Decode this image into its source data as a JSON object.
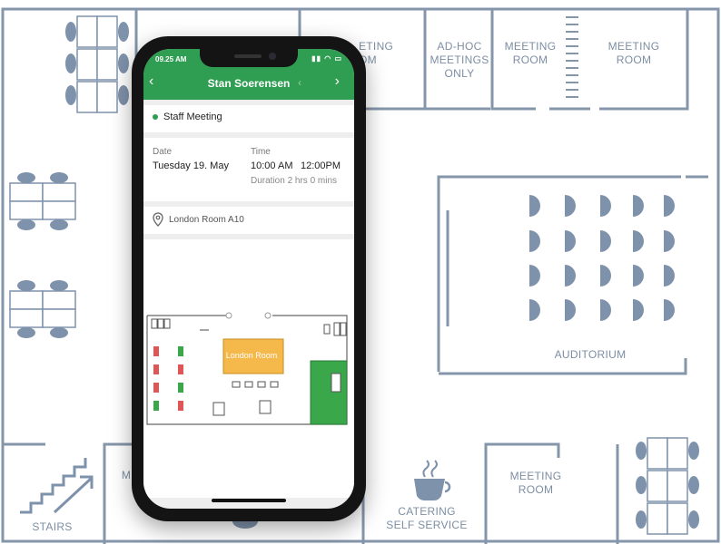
{
  "floorplan": {
    "rooms": {
      "top_meeting_partial": [
        "ETING",
        "OM"
      ],
      "adhoc": [
        "AD-HOC",
        "MEETINGS",
        "ONLY"
      ],
      "meeting_room_1": [
        "MEETING",
        "ROOM"
      ],
      "meeting_room_2": [
        "MEETING",
        "ROOM"
      ],
      "auditorium": "AUDITORIUM",
      "meeting_room_3": [
        "MEETING",
        "ROOM"
      ],
      "catering": [
        "CATERING",
        "SELF SERVICE"
      ],
      "stairs": "STAIRS",
      "partial_bottom": "M"
    },
    "colors": {
      "walls": "#8596ab",
      "furniture": "#7f92ab"
    }
  },
  "phone": {
    "status_bar": {
      "time": "09.25 AM",
      "icons": [
        "signal-icon",
        "wifi-icon",
        "battery-icon"
      ]
    },
    "header": {
      "title": "Stan Soerensen",
      "back_icon": "chevron-left-icon",
      "prev_icon": "chevron-left-icon",
      "next_icon": "chevron-right-icon"
    },
    "event": {
      "name": "Staff Meeting",
      "status_color": "#2f9e52"
    },
    "details": {
      "date_label": "Date",
      "date_value": "Tuesday 19. May",
      "time_label": "Time",
      "start_time": "10:00 AM",
      "end_time": "12:00PM",
      "duration": "Duration 2 hrs 0 mins"
    },
    "location": {
      "icon": "location-pin-icon",
      "name": "London Room A10"
    },
    "mini_map": {
      "highlighted_room": "London Room",
      "colors": {
        "highlight": "#f5b84a",
        "available": "#3aa84a",
        "occupied": "#e05555"
      }
    },
    "accent_color": "#2f9e52"
  }
}
